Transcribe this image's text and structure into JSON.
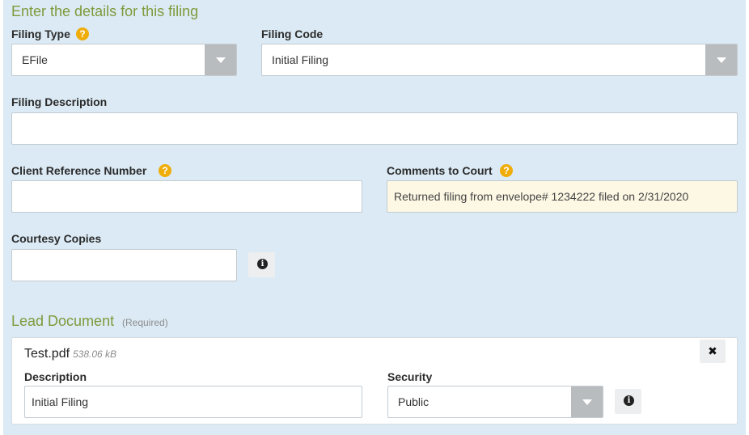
{
  "form": {
    "heading": "Enter the details for this filing",
    "filing_type": {
      "label": "Filing Type",
      "value": "EFile",
      "help": "?"
    },
    "filing_code": {
      "label": "Filing Code",
      "value": "Initial Filing"
    },
    "filing_description": {
      "label": "Filing Description",
      "value": ""
    },
    "client_reference_number": {
      "label": "Client Reference Number",
      "value": "",
      "help": "?"
    },
    "comments_to_court": {
      "label": "Comments to Court",
      "value": "Returned filing from envelope# 1234222 filed on 2/31/2020",
      "help": "?"
    },
    "courtesy_copies": {
      "label": "Courtesy Copies",
      "value": "",
      "info": "i"
    }
  },
  "lead_document": {
    "heading": "Lead Document",
    "required_note": "(Required)",
    "file_name": "Test.pdf",
    "file_size": "538.06 kB",
    "close": "✖",
    "description": {
      "label": "Description",
      "value": "Initial Filing"
    },
    "security": {
      "label": "Security",
      "value": "Public",
      "info": "i"
    }
  },
  "colors": {
    "panel_background": "#dbeaf4",
    "section_heading": "#7f9a3b",
    "help_badge": "#f0ad0a",
    "select_button": "#b8bcbf",
    "comment_field": "#fdf8e4"
  },
  "icons": [
    "help-icon",
    "chevron-down-icon",
    "info-icon",
    "close-icon"
  ]
}
